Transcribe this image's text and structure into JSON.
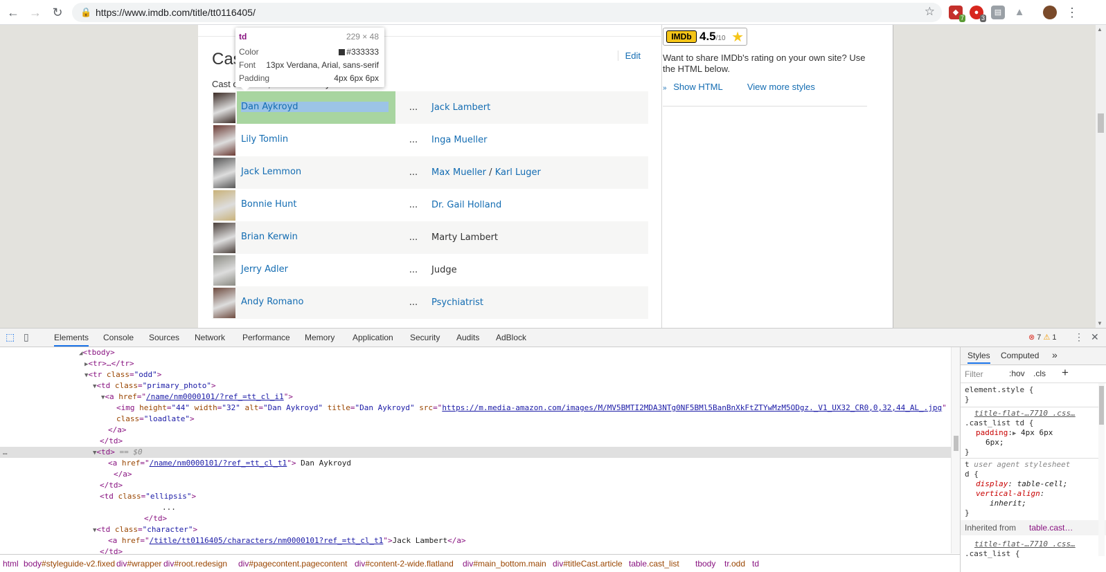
{
  "browser": {
    "url": "https://www.imdb.com/title/tt0116405/",
    "extensions": [
      {
        "name": "ublock-icon",
        "color": "#c4302b",
        "badge": "7"
      },
      {
        "name": "adblock-icon",
        "color": "#d7261e",
        "badge": "3"
      },
      {
        "name": "extension-gray-icon",
        "color": "#9aa0a6",
        "badge": ""
      },
      {
        "name": "drive-icon",
        "color": "#9aa0a6",
        "badge": ""
      }
    ]
  },
  "page": {
    "cast_title": "Cast",
    "edit_label": "Edit",
    "cast_subtitle": "Cast overview, first billed only:",
    "cast": [
      {
        "name": "Dan Aykroyd",
        "ellipsis": "...",
        "character": "Jack Lambert",
        "character_link": true,
        "photo_color": "#3b2b25"
      },
      {
        "name": "Lily Tomlin",
        "ellipsis": "...",
        "character": "Inga Mueller",
        "character_link": true,
        "photo_color": "#6b3a33"
      },
      {
        "name": "Jack Lemmon",
        "ellipsis": "...",
        "character": "Max Mueller",
        "character_b": "Karl Luger",
        "character_link": true,
        "photo_color": "#555"
      },
      {
        "name": "Bonnie Hunt",
        "ellipsis": "...",
        "character": "Dr. Gail Holland",
        "character_link": true,
        "photo_color": "#c9b27a"
      },
      {
        "name": "Brian Kerwin",
        "ellipsis": "...",
        "character": "Marty Lambert",
        "character_link": false,
        "photo_color": "#4a3f3a"
      },
      {
        "name": "Jerry Adler",
        "ellipsis": "...",
        "character": "Judge",
        "character_link": false,
        "photo_color": "#8a8a82"
      },
      {
        "name": "Andy Romano",
        "ellipsis": "...",
        "character": "Psychiatrist",
        "character_link": true,
        "photo_color": "#6d4a3e"
      }
    ],
    "tooltip": {
      "tag": "td",
      "size": "229 × 48",
      "color_label": "Color",
      "color_value": "#333333",
      "font_label": "Font",
      "font_value": "13px Verdana, Arial, sans-serif",
      "padding_label": "Padding",
      "padding_value": "4px 6px 6px"
    },
    "sidebar": {
      "rating": "4.5",
      "rating_scale": "/10",
      "logo": "IMDb",
      "share_text": "Want to share IMDb's rating on your own site? Use the HTML below.",
      "show_html": "Show HTML",
      "view_more": "View more styles"
    }
  },
  "devtools": {
    "tabs": [
      "Elements",
      "Console",
      "Sources",
      "Network",
      "Performance",
      "Memory",
      "Application",
      "Security",
      "Audits",
      "AdBlock"
    ],
    "errors": "7",
    "warnings": "1",
    "style_tabs": [
      "Styles",
      "Computed"
    ],
    "filter_placeholder": "Filter",
    "hov": ":hov",
    "cls": ".cls",
    "plus": "+",
    "dom": {
      "l1": "<tbody>",
      "l2": "<tr>…</tr>",
      "l3_tag": "<tr ",
      "l3_attr": "class",
      "l3_val": "\"odd\"",
      "l4_attr": "class",
      "l4_val": "\"primary_photo\"",
      "l5_href": "/name/nm0000101/?ref_=tt_cl_i1",
      "l6_alt": "\"Dan Aykroyd\"",
      "l6_title": "\"Dan Aykroyd\"",
      "l6_src": "https://m.media-amazon.com/images/M/MV5BMTI2MDA3NTg0NF5BMl5BanBnXkFtZTYwMzM5ODgz._V1_UX32_CR0,0,32,44_AL_.jpg",
      "l6_height": "\"44\"",
      "l6_width": "\"32\"",
      "l7_val": "\"loadlate\"",
      "sel_comment": "== $0",
      "l11_href": "/name/nm0000101/?ref_=tt_cl_t1",
      "l11_text": " Dan Aykroyd",
      "l14_val": "\"ellipsis\"",
      "l15_text": "...",
      "l17_val": "\"character\"",
      "l18_href": "/title/tt0116405/characters/nm0000101?ref_=tt_cl_t1",
      "l18_text": "Jack Lambert"
    },
    "breadcrumbs": [
      {
        "tag": "html",
        "rest": ""
      },
      {
        "tag": "body",
        "rest": "#styleguide-v2.fixed"
      },
      {
        "tag": "div",
        "rest": "#wrapper"
      },
      {
        "tag": "div",
        "rest": "#root.redesign"
      },
      {
        "tag": "div",
        "rest": "#pagecontent.pagecontent"
      },
      {
        "tag": "div",
        "rest": "#content-2-wide.flatland"
      },
      {
        "tag": "div",
        "rest": "#main_bottom.main"
      },
      {
        "tag": "div",
        "rest": "#titleCast.article"
      },
      {
        "tag": "table",
        "rest": ".cast_list"
      },
      {
        "tag": "tbody",
        "rest": ""
      },
      {
        "tag": "tr",
        "rest": ".odd"
      },
      {
        "tag": "td",
        "rest": ""
      }
    ],
    "styles": {
      "element_style": "element.style {",
      "close": "}",
      "src1": "title-flat-…7710 .css…",
      "rule1": ".cast_list td {",
      "prop1": "padding",
      "val1a": "4px 6px",
      "val1b": "6px;",
      "ua_label": "user agent stylesheet",
      "ua_sel_a": "t",
      "ua_sel_b": "d {",
      "prop2": "display",
      "val2": "table-cell;",
      "prop3": "vertical-align",
      "val3": "inherit;",
      "inherited_label": "Inherited from",
      "inherited_from": "table.cast…",
      "src2": "title-flat-…7710 .css…",
      "rule2": ".cast_list {"
    }
  }
}
